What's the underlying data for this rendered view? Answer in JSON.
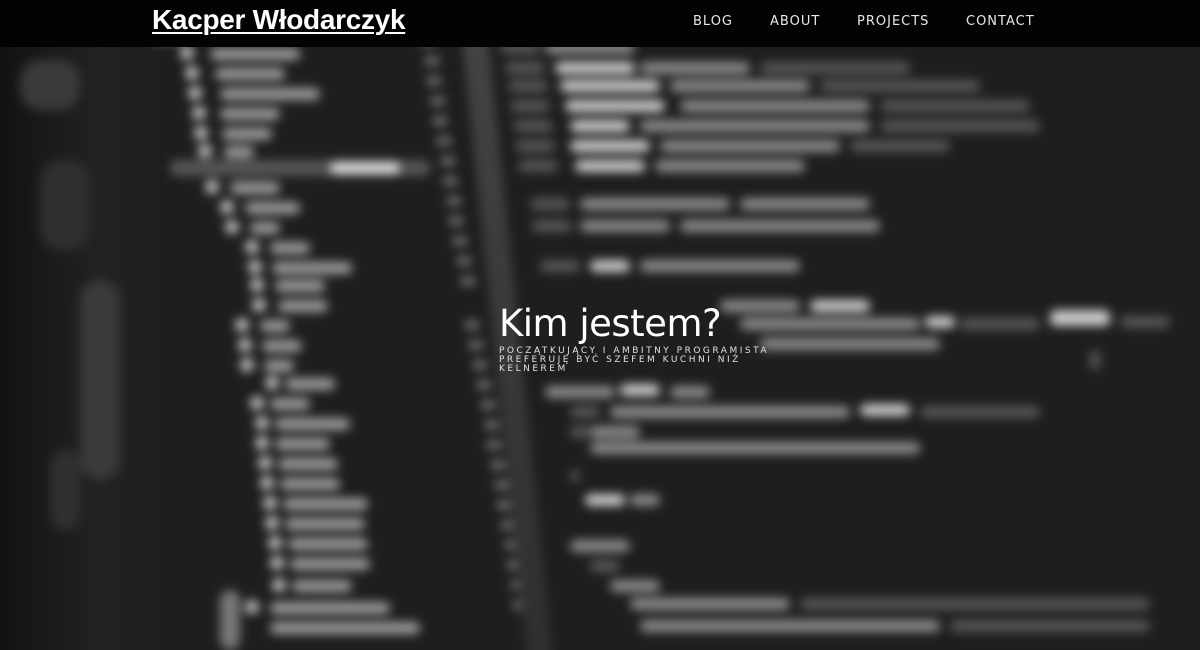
{
  "header": {
    "brand": "Kacper Włodarczyk",
    "nav": [
      {
        "label": "BLOG"
      },
      {
        "label": "ABOUT"
      },
      {
        "label": "PROJECTS"
      },
      {
        "label": "CONTACT"
      }
    ]
  },
  "hero": {
    "title": "Kim jestem?",
    "subtitle_lines": [
      "POCZĄTKUJĄCY I AMBITNY PROGRAMISTA",
      "PREFERUJĘ BYĆ SZEFEM KUCHNI NIŻ",
      "KELNEREM"
    ]
  },
  "colors": {
    "navbar_bg": "#030303",
    "text": "#ffffff",
    "background": "#1b1b1b"
  }
}
